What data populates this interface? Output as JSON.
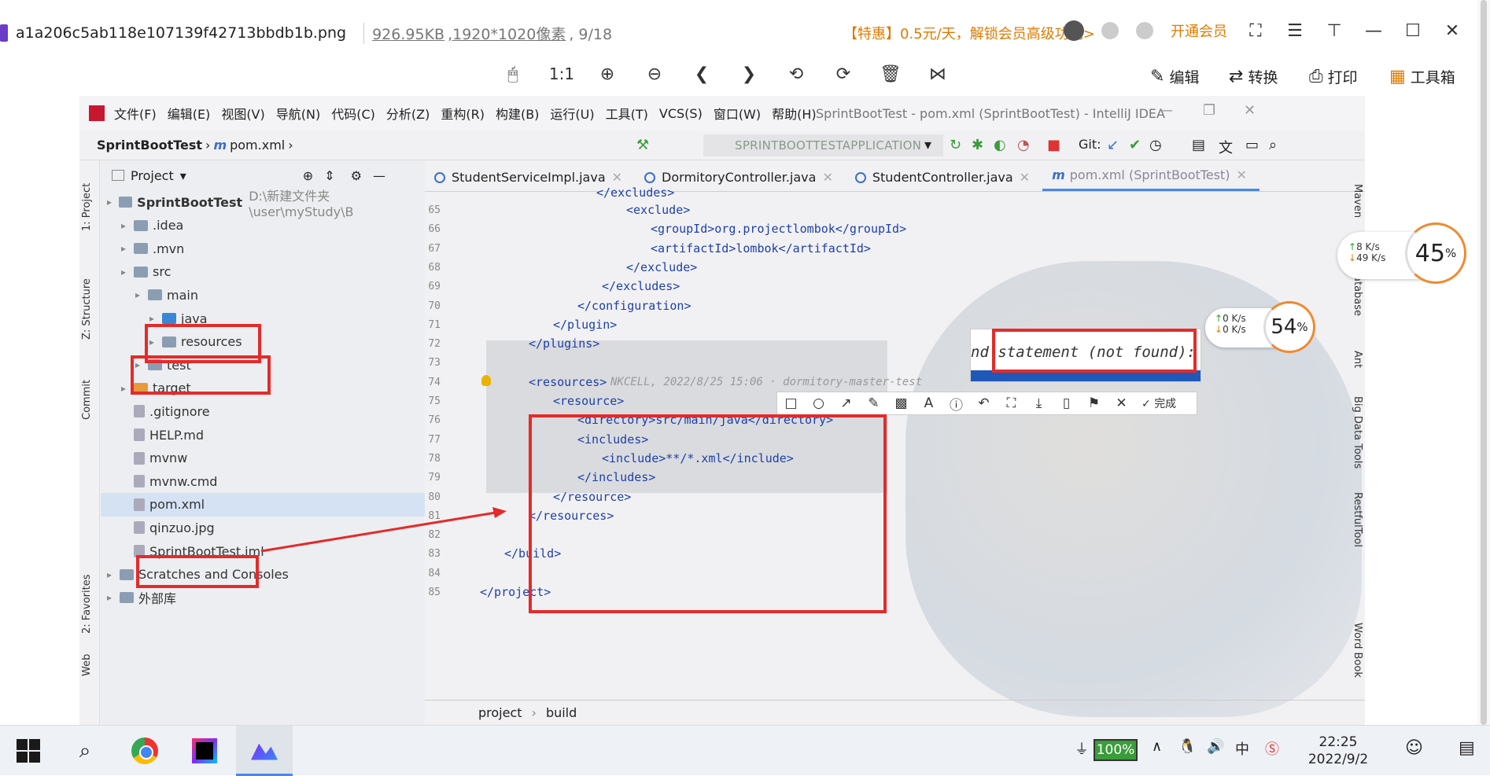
{
  "viewer": {
    "file_name": "a1a206c5ab118e107139f42713bbdb1b.png",
    "file_size": "926.95KB",
    "dimensions": ",1920*1020像素",
    "page_counter": ", 9/18",
    "promo": "【特惠】0.5元/天，解锁会员高级功能>",
    "vip_label": "开通会员",
    "toolbar_zoom_label": "1:1",
    "edit_label": "编辑",
    "convert_label": "转换",
    "print_label": "打印",
    "toolbox_label": "工具箱"
  },
  "ide": {
    "menus": [
      "文件(F)",
      "编辑(E)",
      "视图(V)",
      "导航(N)",
      "代码(C)",
      "分析(Z)",
      "重构(R)",
      "构建(B)",
      "运行(U)",
      "工具(T)",
      "VCS(S)",
      "窗口(W)",
      "帮助(H)"
    ],
    "title": "SprintBootTest - pom.xml (SprintBootTest) - IntelliJ IDEA",
    "breadcrumb_project": "SprintBootTest",
    "breadcrumb_file": "pom.xml",
    "run_config": "SPRINTBOOTTESTAPPLICATION",
    "git_label": "Git:",
    "left_tabs": [
      "1: Project",
      "Z: Structure",
      "Commit",
      "2: Favorites",
      "Web"
    ],
    "right_tabs": [
      "Maven",
      "Database",
      "Ant",
      "Big Data Tools",
      "RestfulTool",
      "Word Book"
    ],
    "project_header": "Project",
    "tree": [
      {
        "label": "SprintBootTest",
        "path": "D:\\新建文件夹\\user\\myStudy\\B",
        "indent": 0,
        "kind": "folder",
        "bold": true
      },
      {
        "label": ".idea",
        "indent": 1,
        "kind": "folder"
      },
      {
        "label": ".mvn",
        "indent": 1,
        "kind": "folder"
      },
      {
        "label": "src",
        "indent": 1,
        "kind": "folder"
      },
      {
        "label": "main",
        "indent": 2,
        "kind": "folder"
      },
      {
        "label": "java",
        "indent": 3,
        "kind": "folder-blue"
      },
      {
        "label": "resources",
        "indent": 3,
        "kind": "folder"
      },
      {
        "label": "test",
        "indent": 2,
        "kind": "folder"
      },
      {
        "label": "target",
        "indent": 1,
        "kind": "folder-orange"
      },
      {
        "label": ".gitignore",
        "indent": 1,
        "kind": "file"
      },
      {
        "label": "HELP.md",
        "indent": 1,
        "kind": "file"
      },
      {
        "label": "mvnw",
        "indent": 1,
        "kind": "file"
      },
      {
        "label": "mvnw.cmd",
        "indent": 1,
        "kind": "file"
      },
      {
        "label": "pom.xml",
        "indent": 1,
        "kind": "file",
        "selected": true
      },
      {
        "label": "qinzuo.jpg",
        "indent": 1,
        "kind": "file"
      },
      {
        "label": "SprintBootTest.iml",
        "indent": 1,
        "kind": "file"
      },
      {
        "label": "Scratches and Consoles",
        "indent": 0,
        "kind": "folder"
      },
      {
        "label": "外部库",
        "indent": 0,
        "kind": "folder"
      }
    ],
    "tabs": [
      "StudentServiceImpl.java",
      "DormitoryController.java",
      "StudentController.java",
      "pom.xml (SprintBootTest)"
    ],
    "code_lines": [
      {
        "n": "65",
        "code": "<exclude>",
        "indent": 6
      },
      {
        "n": "66",
        "code": "<groupId>org.projectlombok</groupId>",
        "indent": 7
      },
      {
        "n": "67",
        "code": "<artifactId>lombok</artifactId>",
        "indent": 7
      },
      {
        "n": "68",
        "code": "</exclude>",
        "indent": 6
      },
      {
        "n": "69",
        "code": "</excludes>",
        "indent": 5
      },
      {
        "n": "70",
        "code": "</configuration>",
        "indent": 4
      },
      {
        "n": "71",
        "code": "</plugin>",
        "indent": 3
      },
      {
        "n": "72",
        "code": "</plugins>",
        "indent": 2
      },
      {
        "n": "73",
        "code": "",
        "indent": 0
      },
      {
        "n": "74",
        "code": "<resources>",
        "indent": 2
      },
      {
        "n": "75",
        "code": "<resource>",
        "indent": 3
      },
      {
        "n": "76",
        "code": "<directory>src/main/java</directory>",
        "indent": 4
      },
      {
        "n": "77",
        "code": "<includes>",
        "indent": 4
      },
      {
        "n": "78",
        "code": "<include>**/*.xml</include>",
        "indent": 5
      },
      {
        "n": "79",
        "code": "</includes>",
        "indent": 4
      },
      {
        "n": "80",
        "code": "</resource>",
        "indent": 3
      },
      {
        "n": "81",
        "code": "</resources>",
        "indent": 2
      },
      {
        "n": "82",
        "code": "",
        "indent": 0
      },
      {
        "n": "83",
        "code": "</build>",
        "indent": 1
      },
      {
        "n": "84",
        "code": "",
        "indent": 0
      },
      {
        "n": "85",
        "code": "</project>",
        "indent": 0
      }
    ],
    "partial_top_line": "</excludes>",
    "blame_annotation": "NKCELL, 2022/8/25 15:06 · dormitory-master-test",
    "popup_text": "nd statement (not found):",
    "screenshot_done": "完成",
    "status_path": [
      "project",
      "build"
    ]
  },
  "monitors": {
    "a": {
      "up": "8",
      "down": "49",
      "unit": "K/s",
      "percent": "45",
      "pct": "%"
    },
    "b": {
      "up": "0",
      "down": "0",
      "unit": "K/s",
      "percent": "54",
      "pct": "%"
    }
  },
  "taskbar": {
    "battery": "100%",
    "ime": "中",
    "time": "22:25",
    "date": "2022/9/2"
  }
}
